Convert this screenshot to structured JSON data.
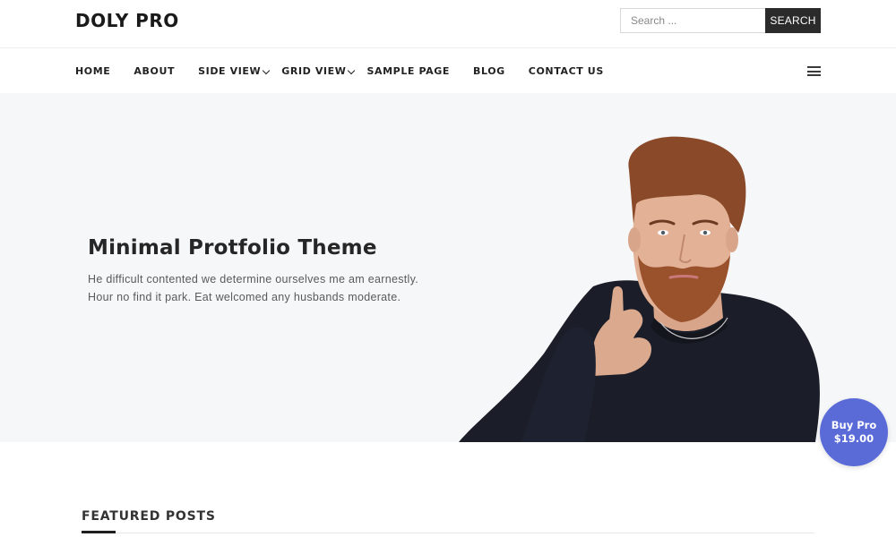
{
  "header": {
    "site_title": "DOLY PRO",
    "search": {
      "placeholder": "Search ...",
      "value": "",
      "button_label": "SEARCH"
    }
  },
  "nav": {
    "items": [
      {
        "label": "HOME"
      },
      {
        "label": "ABOUT"
      },
      {
        "label": "SIDE VIEW",
        "dropdown": true
      },
      {
        "label": "GRID VIEW",
        "dropdown": true
      },
      {
        "label": "SAMPLE PAGE"
      },
      {
        "label": "BLOG"
      },
      {
        "label": "CONTACT US"
      }
    ],
    "menu_icon": "hamburger-menu-icon"
  },
  "hero": {
    "title": "Minimal Protfolio Theme",
    "text_line1": "He difficult contented we determine ourselves me am earnestly.",
    "text_line2": "Hour no find it park. Eat welcomed any husbands moderate.",
    "image": "bearded-man-portrait"
  },
  "buy_pro": {
    "line1": "Buy Pro",
    "line2": "$19.00",
    "color": "#5a6bd8"
  },
  "featured": {
    "title": "FEATURED POSTS"
  }
}
